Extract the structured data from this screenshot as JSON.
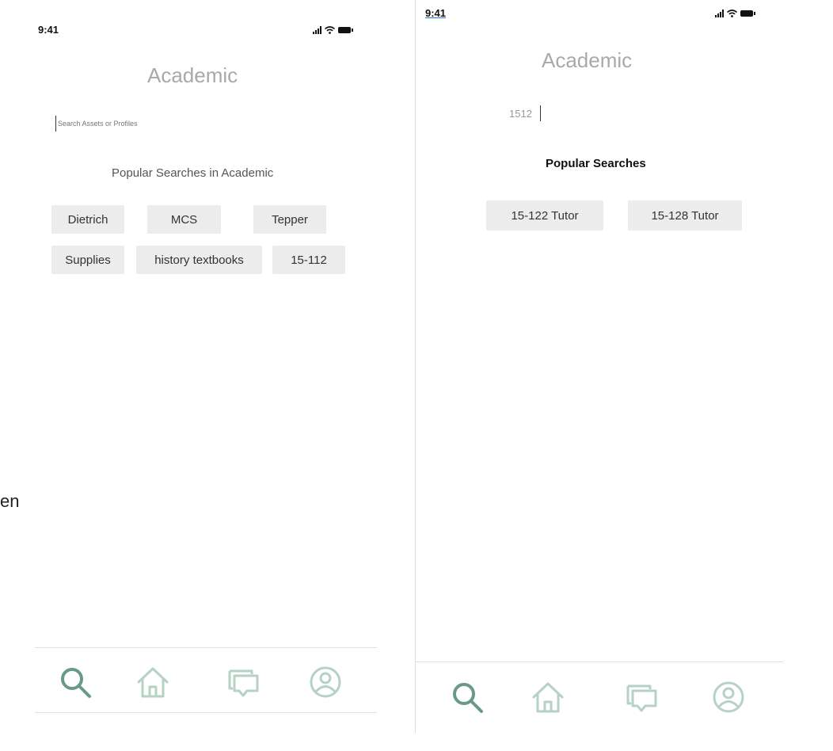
{
  "stray_text": "en",
  "left_screen": {
    "status_time": "9:41",
    "title": "Academic",
    "search": {
      "placeholder": "Search Assets or Profiles",
      "value": ""
    },
    "section_heading": "Popular Searches in Academic",
    "chips": [
      "Dietrich",
      "MCS",
      "Tepper",
      "Supplies",
      "history textbooks",
      "15-112"
    ]
  },
  "right_screen": {
    "status_time": "9:41",
    "title": "Academic",
    "search": {
      "value": "1512"
    },
    "section_heading": "Popular Searches",
    "chips": [
      "15-122 Tutor",
      "15-128 Tutor"
    ]
  },
  "bottom_nav": {
    "items": [
      {
        "icon": "search-icon",
        "active": true
      },
      {
        "icon": "home-icon",
        "active": false
      },
      {
        "icon": "chat-icon",
        "active": false
      },
      {
        "icon": "profile-icon",
        "active": false
      }
    ],
    "active_color": "#6a9a86",
    "inactive_color": "#b5d2c5"
  }
}
